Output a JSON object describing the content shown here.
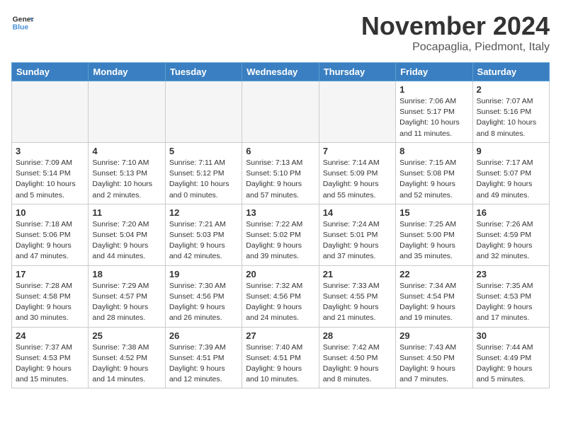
{
  "header": {
    "logo_line1": "General",
    "logo_line2": "Blue",
    "month": "November 2024",
    "location": "Pocapaglia, Piedmont, Italy"
  },
  "weekdays": [
    "Sunday",
    "Monday",
    "Tuesday",
    "Wednesday",
    "Thursday",
    "Friday",
    "Saturday"
  ],
  "weeks": [
    [
      {
        "day": "",
        "info": ""
      },
      {
        "day": "",
        "info": ""
      },
      {
        "day": "",
        "info": ""
      },
      {
        "day": "",
        "info": ""
      },
      {
        "day": "",
        "info": ""
      },
      {
        "day": "1",
        "info": "Sunrise: 7:06 AM\nSunset: 5:17 PM\nDaylight: 10 hours\nand 11 minutes."
      },
      {
        "day": "2",
        "info": "Sunrise: 7:07 AM\nSunset: 5:16 PM\nDaylight: 10 hours\nand 8 minutes."
      }
    ],
    [
      {
        "day": "3",
        "info": "Sunrise: 7:09 AM\nSunset: 5:14 PM\nDaylight: 10 hours\nand 5 minutes."
      },
      {
        "day": "4",
        "info": "Sunrise: 7:10 AM\nSunset: 5:13 PM\nDaylight: 10 hours\nand 2 minutes."
      },
      {
        "day": "5",
        "info": "Sunrise: 7:11 AM\nSunset: 5:12 PM\nDaylight: 10 hours\nand 0 minutes."
      },
      {
        "day": "6",
        "info": "Sunrise: 7:13 AM\nSunset: 5:10 PM\nDaylight: 9 hours\nand 57 minutes."
      },
      {
        "day": "7",
        "info": "Sunrise: 7:14 AM\nSunset: 5:09 PM\nDaylight: 9 hours\nand 55 minutes."
      },
      {
        "day": "8",
        "info": "Sunrise: 7:15 AM\nSunset: 5:08 PM\nDaylight: 9 hours\nand 52 minutes."
      },
      {
        "day": "9",
        "info": "Sunrise: 7:17 AM\nSunset: 5:07 PM\nDaylight: 9 hours\nand 49 minutes."
      }
    ],
    [
      {
        "day": "10",
        "info": "Sunrise: 7:18 AM\nSunset: 5:06 PM\nDaylight: 9 hours\nand 47 minutes."
      },
      {
        "day": "11",
        "info": "Sunrise: 7:20 AM\nSunset: 5:04 PM\nDaylight: 9 hours\nand 44 minutes."
      },
      {
        "day": "12",
        "info": "Sunrise: 7:21 AM\nSunset: 5:03 PM\nDaylight: 9 hours\nand 42 minutes."
      },
      {
        "day": "13",
        "info": "Sunrise: 7:22 AM\nSunset: 5:02 PM\nDaylight: 9 hours\nand 39 minutes."
      },
      {
        "day": "14",
        "info": "Sunrise: 7:24 AM\nSunset: 5:01 PM\nDaylight: 9 hours\nand 37 minutes."
      },
      {
        "day": "15",
        "info": "Sunrise: 7:25 AM\nSunset: 5:00 PM\nDaylight: 9 hours\nand 35 minutes."
      },
      {
        "day": "16",
        "info": "Sunrise: 7:26 AM\nSunset: 4:59 PM\nDaylight: 9 hours\nand 32 minutes."
      }
    ],
    [
      {
        "day": "17",
        "info": "Sunrise: 7:28 AM\nSunset: 4:58 PM\nDaylight: 9 hours\nand 30 minutes."
      },
      {
        "day": "18",
        "info": "Sunrise: 7:29 AM\nSunset: 4:57 PM\nDaylight: 9 hours\nand 28 minutes."
      },
      {
        "day": "19",
        "info": "Sunrise: 7:30 AM\nSunset: 4:56 PM\nDaylight: 9 hours\nand 26 minutes."
      },
      {
        "day": "20",
        "info": "Sunrise: 7:32 AM\nSunset: 4:56 PM\nDaylight: 9 hours\nand 24 minutes."
      },
      {
        "day": "21",
        "info": "Sunrise: 7:33 AM\nSunset: 4:55 PM\nDaylight: 9 hours\nand 21 minutes."
      },
      {
        "day": "22",
        "info": "Sunrise: 7:34 AM\nSunset: 4:54 PM\nDaylight: 9 hours\nand 19 minutes."
      },
      {
        "day": "23",
        "info": "Sunrise: 7:35 AM\nSunset: 4:53 PM\nDaylight: 9 hours\nand 17 minutes."
      }
    ],
    [
      {
        "day": "24",
        "info": "Sunrise: 7:37 AM\nSunset: 4:53 PM\nDaylight: 9 hours\nand 15 minutes."
      },
      {
        "day": "25",
        "info": "Sunrise: 7:38 AM\nSunset: 4:52 PM\nDaylight: 9 hours\nand 14 minutes."
      },
      {
        "day": "26",
        "info": "Sunrise: 7:39 AM\nSunset: 4:51 PM\nDaylight: 9 hours\nand 12 minutes."
      },
      {
        "day": "27",
        "info": "Sunrise: 7:40 AM\nSunset: 4:51 PM\nDaylight: 9 hours\nand 10 minutes."
      },
      {
        "day": "28",
        "info": "Sunrise: 7:42 AM\nSunset: 4:50 PM\nDaylight: 9 hours\nand 8 minutes."
      },
      {
        "day": "29",
        "info": "Sunrise: 7:43 AM\nSunset: 4:50 PM\nDaylight: 9 hours\nand 7 minutes."
      },
      {
        "day": "30",
        "info": "Sunrise: 7:44 AM\nSunset: 4:49 PM\nDaylight: 9 hours\nand 5 minutes."
      }
    ]
  ]
}
